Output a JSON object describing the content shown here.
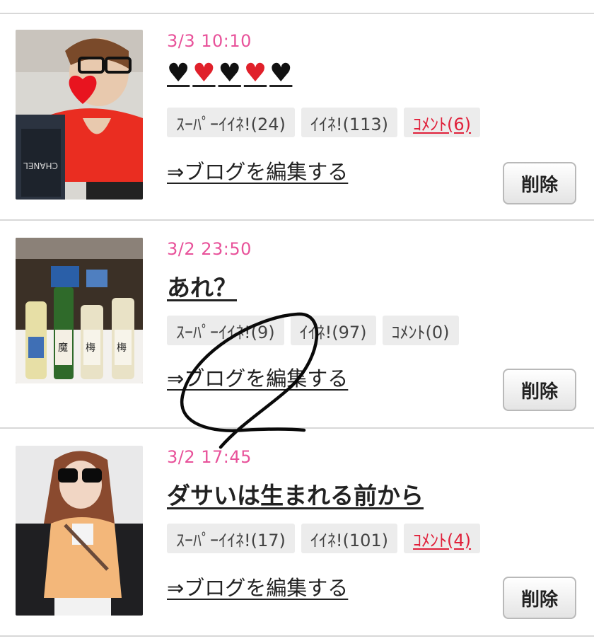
{
  "posts": [
    {
      "date": "3/3 10:10",
      "title": "",
      "hearts": [
        "black",
        "red",
        "black",
        "red",
        "black"
      ],
      "super_like": "ｽｰﾊﾟｰｲｲﾈ!(24)",
      "like": "ｲｲﾈ!(113)",
      "comment": "ｺﾒﾝﾄ(6)",
      "comment_active": true,
      "edit_link": "⇒ブログを編集する",
      "delete_label": "削除"
    },
    {
      "date": "3/2 23:50",
      "title": "あれ？",
      "super_like": "ｽｰﾊﾟｰｲｲﾈ!(9)",
      "like": "ｲｲﾈ!(97)",
      "comment": "ｺﾒﾝﾄ(0)",
      "comment_active": false,
      "edit_link": "⇒ブログを編集する",
      "delete_label": "削除"
    },
    {
      "date": "3/2 17:45",
      "title": "ダサいは生まれる前から",
      "super_like": "ｽｰﾊﾟｰｲｲﾈ!(17)",
      "like": "ｲｲﾈ!(101)",
      "comment": "ｺﾒﾝﾄ(4)",
      "comment_active": true,
      "edit_link": "⇒ブログを編集する",
      "delete_label": "削除"
    }
  ],
  "colors": {
    "date": "#e8529a",
    "comment_active": "#e0203a",
    "heart_red": "#e0202a",
    "divider": "#d8d8d8"
  }
}
